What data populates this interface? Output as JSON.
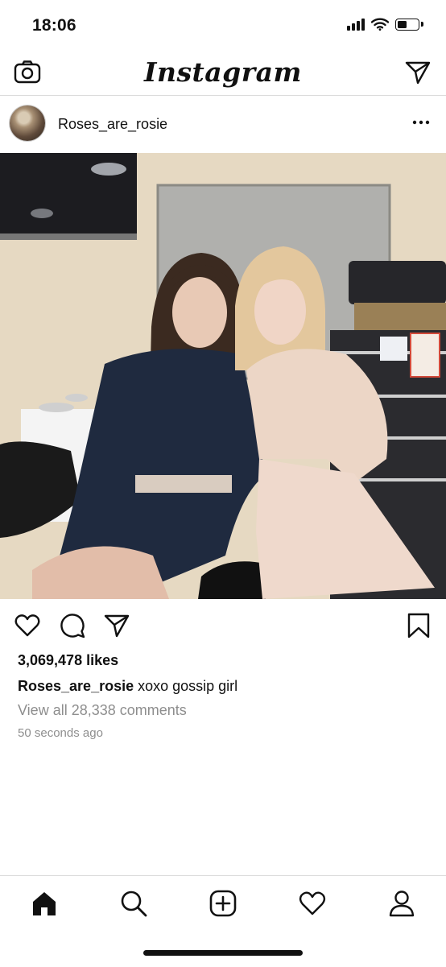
{
  "status_bar": {
    "time": "18:06",
    "battery_level": 0.5
  },
  "header": {
    "logo": "Instagram"
  },
  "post": {
    "username": "Roses_are_rosie",
    "likes_text": "3,069,478 likes",
    "caption_user": "Roses_are_rosie",
    "caption_text": " xoxo gossip girl",
    "comments_link": "View all 28,338 comments",
    "timestamp": "50 seconds ago"
  },
  "icons": {
    "camera": "camera-icon",
    "direct": "paper-plane-icon",
    "more": "more-dots-icon",
    "like": "heart-icon",
    "comment": "comment-bubble-icon",
    "share": "share-plane-icon",
    "save": "bookmark-icon",
    "tabs": [
      "home-icon",
      "search-icon",
      "add-post-icon",
      "activity-heart-icon",
      "profile-icon"
    ]
  },
  "colors": {
    "separator": "#dbdbdb",
    "muted_text": "#8e8e8e"
  }
}
